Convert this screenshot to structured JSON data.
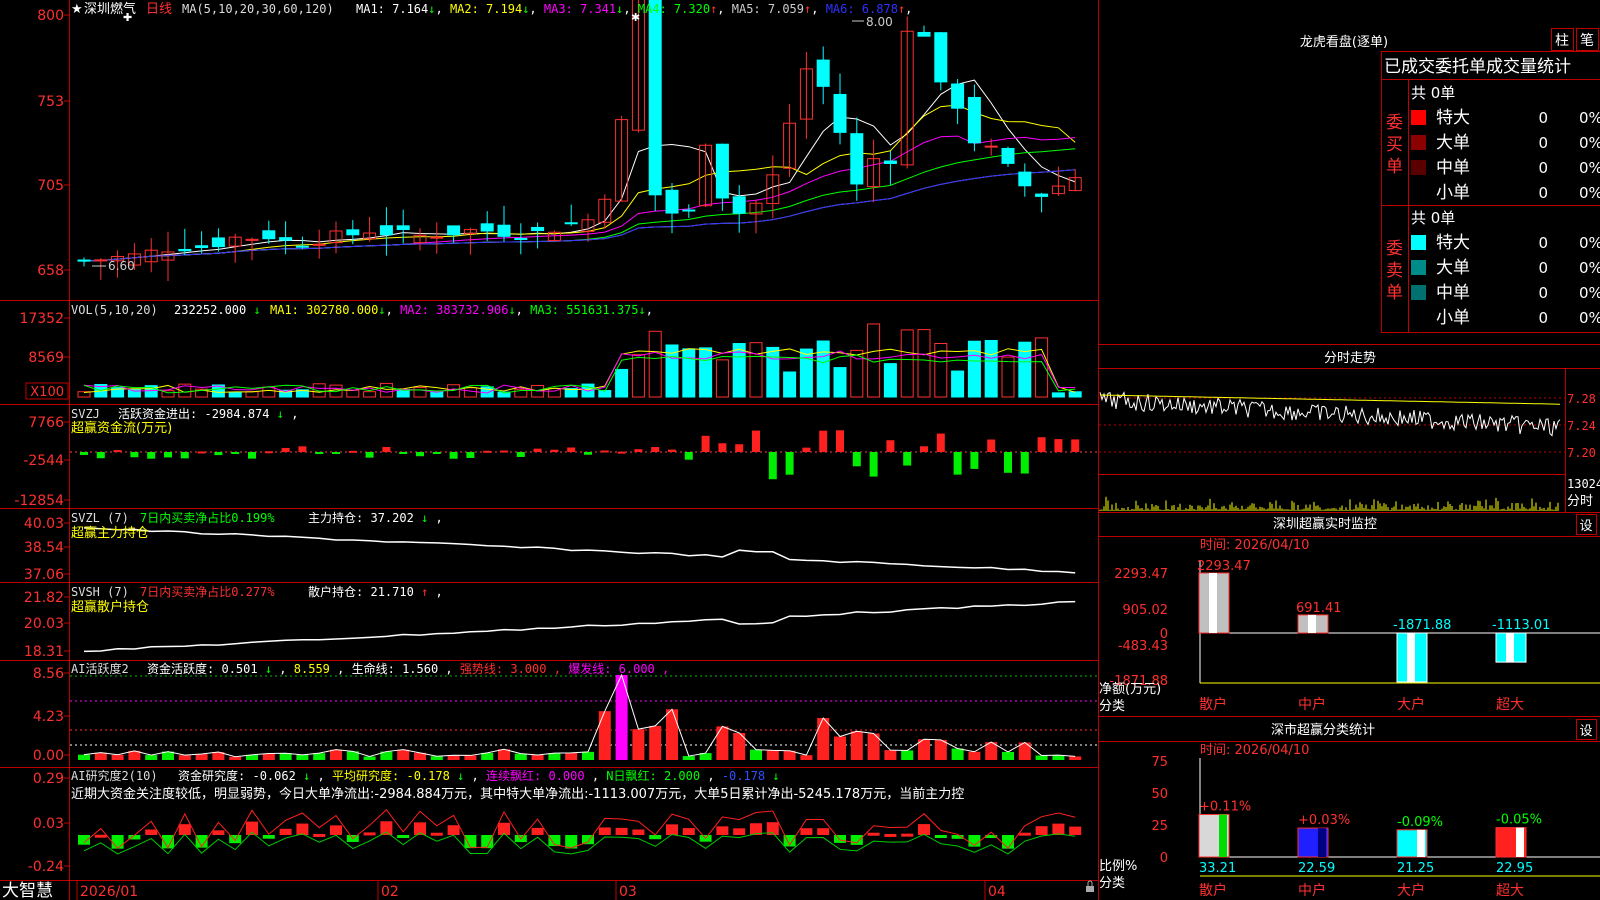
{
  "main": {
    "star": "★",
    "stock_name": "深圳燃气",
    "period": "日线",
    "ma_label": "MA(5,10,20,30,60,120)",
    "ma_items": [
      {
        "label": "MA1:",
        "value": "7.164",
        "arrow": "↓",
        "color": "#ffffff"
      },
      {
        "label": "MA2:",
        "value": "7.194",
        "arrow": "↓",
        "color": "#ffff00"
      },
      {
        "label": "MA3:",
        "value": "7.341",
        "arrow": "↓",
        "color": "#ff00ff"
      },
      {
        "label": "MA4:",
        "value": "7.320",
        "arrow": "↑",
        "color": "#00ff00"
      },
      {
        "label": "MA5:",
        "value": "7.059",
        "arrow": "↑",
        "color": "#cccccc"
      },
      {
        "label": "MA6:",
        "value": "6.878",
        "arrow": "↑",
        "color": "#3030ff"
      }
    ],
    "price_axis": [
      "800",
      "753",
      "705",
      "658"
    ],
    "high_mark": "8.00",
    "low_mark": "6.60"
  },
  "vol": {
    "label": "VOL(5,10,20)",
    "value": "232252.000",
    "value_arrow": "↓",
    "items": [
      {
        "label": "MA1:",
        "value": "302780.000",
        "arrow": "↓",
        "color": "#ffff00"
      },
      {
        "label": "MA2:",
        "value": "383732.906",
        "arrow": "↓",
        "color": "#ff00ff"
      },
      {
        "label": "MA3:",
        "value": "551631.375",
        "arrow": "↓",
        "color": "#00ff00"
      }
    ],
    "axis": [
      "17352",
      "8569",
      "X100"
    ]
  },
  "svzj": {
    "label": "SVZJ",
    "title": "活跃资金进出:",
    "value": "-2984.874",
    "value_arrow": "↓",
    "sep": ",",
    "sub": "超赢资金流(万元)",
    "axis": [
      "7766",
      "-2544",
      "-12854"
    ]
  },
  "svzl": {
    "label": "SVZL (7)",
    "desc": "7日内买卖净占比0.199%",
    "hold_label": "主力持仓:",
    "hold_value": "37.202",
    "hold_arrow": "↓",
    "sep": ",",
    "sub": "超赢主力持仓",
    "axis": [
      "40.03",
      "38.54",
      "37.06"
    ]
  },
  "svsh": {
    "label": "SVSH (7)",
    "desc": "7日内买卖净占比0.277%",
    "hold_label": "散户持仓:",
    "hold_value": "21.710",
    "hold_arrow": "↑",
    "sep": ",",
    "sub": "超赢散户持仓",
    "axis": [
      "21.82",
      "20.03",
      "18.31"
    ]
  },
  "ai": {
    "label": "AI活跃度2",
    "fund_label": "资金活跃度:",
    "fund_value": "0.501",
    "fund_arrow": "↓",
    "v2": "8.559",
    "life_label": "生命线:",
    "life_value": "1.560",
    "strong_label": "强势线:",
    "strong_value": "3.000",
    "burst_label": "爆发线:",
    "burst_value": "6.000",
    "axis": [
      "8.56",
      "4.23",
      "0.00"
    ]
  },
  "research": {
    "label": "AI研究度2(10)",
    "r_label": "资金研究度:",
    "r_value": "-0.062",
    "r_arrow": "↓",
    "avg_label": "平均研究度:",
    "avg_value": "-0.178",
    "avg_arrow": "↓",
    "red_label": "连续飘红:",
    "red_value": "0.000",
    "nred_label": "N日飘红:",
    "nred_value": "2.000",
    "last_value": "-0.178",
    "last_arrow": "↓",
    "comment": "近期大资金关注度较低，明显弱势，今日大单净流出:-2984.884万元，其中特大单净流出:-1113.007万元，大单5日累计净出-5245.178万元，当前主力控",
    "axis": [
      "0.29",
      "0.03",
      "-0.24"
    ]
  },
  "xaxis": [
    "2026/01",
    "02",
    "03",
    "04"
  ],
  "footer": {
    "brand": "大智慧"
  },
  "dragon": {
    "title": "龙虎看盘(逐单)",
    "btn_bar": "柱",
    "btn_pen": "笔",
    "header": "已成交委托单成交量统计",
    "buy_total": "共 0单",
    "sell_total": "共 0单",
    "buy_side": "委买单",
    "sell_side": "委卖单",
    "buy_rows": [
      {
        "name": "特大",
        "count": "0",
        "pct": "0%",
        "color": "#ff0000"
      },
      {
        "name": "大单",
        "count": "0",
        "pct": "0%",
        "color": "#8b0000"
      },
      {
        "name": "中单",
        "count": "0",
        "pct": "0%",
        "color": "#5a0000"
      },
      {
        "name": "小单",
        "count": "0",
        "pct": "0%",
        "color": ""
      }
    ],
    "sell_rows": [
      {
        "name": "特大",
        "count": "0",
        "pct": "0%",
        "color": "#00ffff"
      },
      {
        "name": "大单",
        "count": "0",
        "pct": "0%",
        "color": "#008b8b"
      },
      {
        "name": "中单",
        "count": "0",
        "pct": "0%",
        "color": "#007070"
      },
      {
        "name": "小单",
        "count": "0",
        "pct": "0%",
        "color": ""
      }
    ]
  },
  "intraday": {
    "title": "分时走势",
    "price_axis": [
      "7.28",
      "7.24",
      "7.20"
    ],
    "vol_label": "13024",
    "footer": "分时"
  },
  "monitor": {
    "title": "深圳超赢实时监控",
    "set": "设",
    "time": "时间: 2026/04/10",
    "axis": [
      "2293.47",
      "905.02",
      "0",
      "-483.43",
      "-1871.88"
    ],
    "ylabel": "净额(万元)",
    "xlabel": "分类",
    "bars": [
      {
        "name": "散户",
        "label": "2293.47",
        "value": 2293.47
      },
      {
        "name": "中户",
        "label": "691.41",
        "value": 691.41
      },
      {
        "name": "大户",
        "label": "-1871.88",
        "value": -1871.88
      },
      {
        "name": "超大",
        "label": "-1113.01",
        "value": -1113.01
      }
    ]
  },
  "stats": {
    "title": "深市超赢分类统计",
    "set": "设",
    "time": "时间: 2026/04/10",
    "axis": [
      "75",
      "50",
      "25",
      "0"
    ],
    "ylabel": "比例%",
    "xlabel": "分类",
    "bars": [
      {
        "name": "散户",
        "value": 33.21,
        "label": "33.21",
        "change": "+0.11%",
        "fill": "#d8d8d8",
        "stripe": "#00dd00"
      },
      {
        "name": "中户",
        "value": 22.59,
        "label": "22.59",
        "change": "+0.03%",
        "fill": "#2020ff",
        "stripe": "#000080"
      },
      {
        "name": "大户",
        "value": 21.25,
        "label": "21.25",
        "change": "-0.09%",
        "fill": "#00ffff",
        "stripe": "#ffffff"
      },
      {
        "name": "超大",
        "value": 22.95,
        "label": "22.95",
        "change": "-0.05%",
        "fill": "#ff2020",
        "stripe": "#ffffff"
      }
    ]
  }
}
